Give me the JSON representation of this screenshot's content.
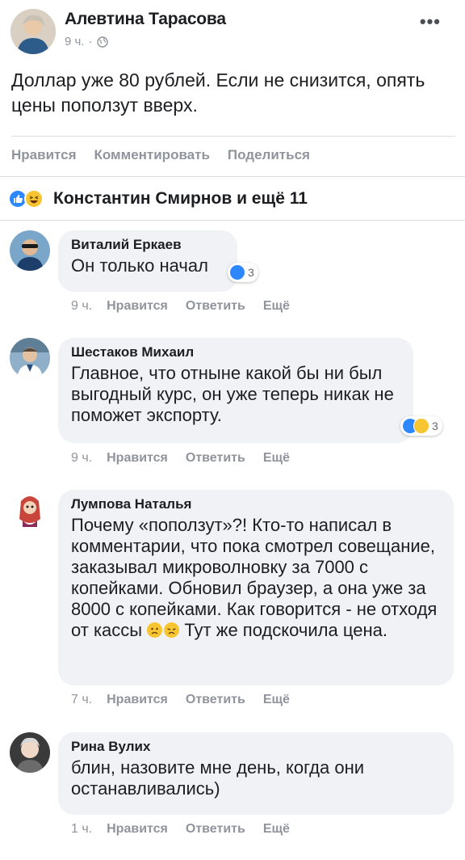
{
  "post": {
    "author": "Алевтина Тарасова",
    "time": "9 ч.",
    "separator": "·",
    "text": "Доллар уже 80 рублей. Если не снизится, опять цены поползут вверх.",
    "more_label": "•••"
  },
  "actions": {
    "like": "Нравится",
    "comment": "Комментировать",
    "share": "Поделиться"
  },
  "reactions": {
    "summary": "Константин Смирнов и ещё 11",
    "icons": [
      "like-icon",
      "haha-icon"
    ]
  },
  "comment_actions": {
    "like": "Нравится",
    "reply": "Ответить",
    "more": "Ещё"
  },
  "comments": [
    {
      "name": "Виталий Еркаев",
      "text": "Он только начал",
      "time": "9 ч.",
      "reaction_count": "3",
      "reaction_icons": [
        "like-icon"
      ]
    },
    {
      "name": "Шестаков Михаил",
      "text": "Главное, что отныне какой бы ни был выгодный курс, он уже теперь никак не поможет экспорту.",
      "time": "9 ч.",
      "reaction_count": "3",
      "reaction_icons": [
        "like-icon",
        "sad-icon"
      ]
    },
    {
      "name": "Лумпова Наталья",
      "text_before": "Почему «поползут»?! Кто-то написал в комментарии, что пока смотрел совещание, заказывал микроволновку за 7000 с копейками. Обновил браузер, а она уже за 8000 с копейками. Как говорится - не отходя от кассы",
      "text_after": " Тут же подскочила цена.",
      "time": "7 ч.",
      "inline_emojis": [
        "frown-emoji",
        "disappointed-emoji"
      ]
    },
    {
      "name": "Рина Вулих",
      "text": "блин, назовите мне день, когда они останавливались)",
      "time": "1 ч."
    }
  ],
  "colors": {
    "like_blue": "#2d88ff",
    "haha_yellow": "#f7c531",
    "bubble_bg": "#f0f2f5",
    "muted_text": "#90949c"
  }
}
